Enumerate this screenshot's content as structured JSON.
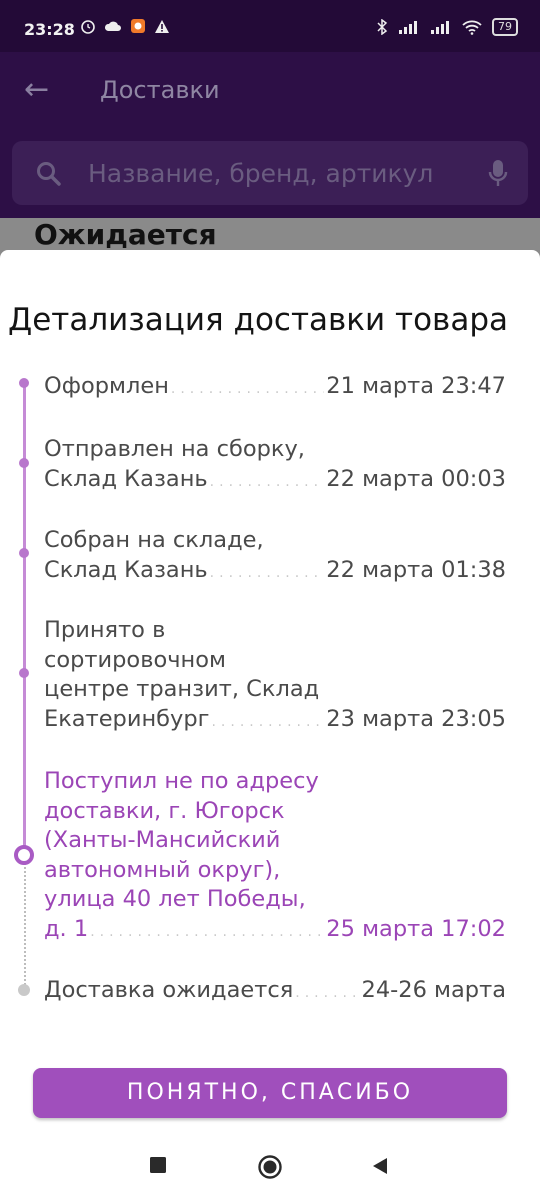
{
  "status_bar": {
    "time": "23:28",
    "battery": "79"
  },
  "toolbar": {
    "title": "Доставки"
  },
  "search": {
    "placeholder": "Название, бренд, артикул"
  },
  "background_section_title": "Ожидается",
  "sheet": {
    "title": "Детализация доставки товара",
    "events": [
      {
        "lines": [],
        "last": "Оформлен",
        "date": "21 марта 23:47"
      },
      {
        "lines": [
          "Отправлен на сборку,"
        ],
        "last": "Склад Казань",
        "date": "22 марта 00:03"
      },
      {
        "lines": [
          "Собран на складе,"
        ],
        "last": "Склад Казань",
        "date": "22 марта 01:38"
      },
      {
        "lines": [
          "Принято в",
          "сортировочном",
          "центре транзит, Склад"
        ],
        "last": "Екатеринбург",
        "date": "23 марта 23:05"
      },
      {
        "lines": [
          "Поступил не по адресу",
          "доставки, г. Югорск",
          "(Ханты-Мансийский",
          "автономный округ),",
          "улица 40 лет Победы,"
        ],
        "last": "д. 1",
        "date": "25 марта 17:02"
      },
      {
        "lines": [],
        "last": "Доставка ожидается",
        "date": "24-26 марта"
      }
    ],
    "button_label": "ПОНЯТНО, СПАСИБО"
  },
  "colors": {
    "accent": "#a04fbc",
    "timeline": "#c58bd6",
    "toolbar": "#2d0f46"
  },
  "icons": {
    "back": "arrow-left-icon",
    "search": "search-icon",
    "mic": "microphone-icon",
    "nav_recent": "square-icon",
    "nav_home": "circle-icon",
    "nav_back": "triangle-icon"
  }
}
